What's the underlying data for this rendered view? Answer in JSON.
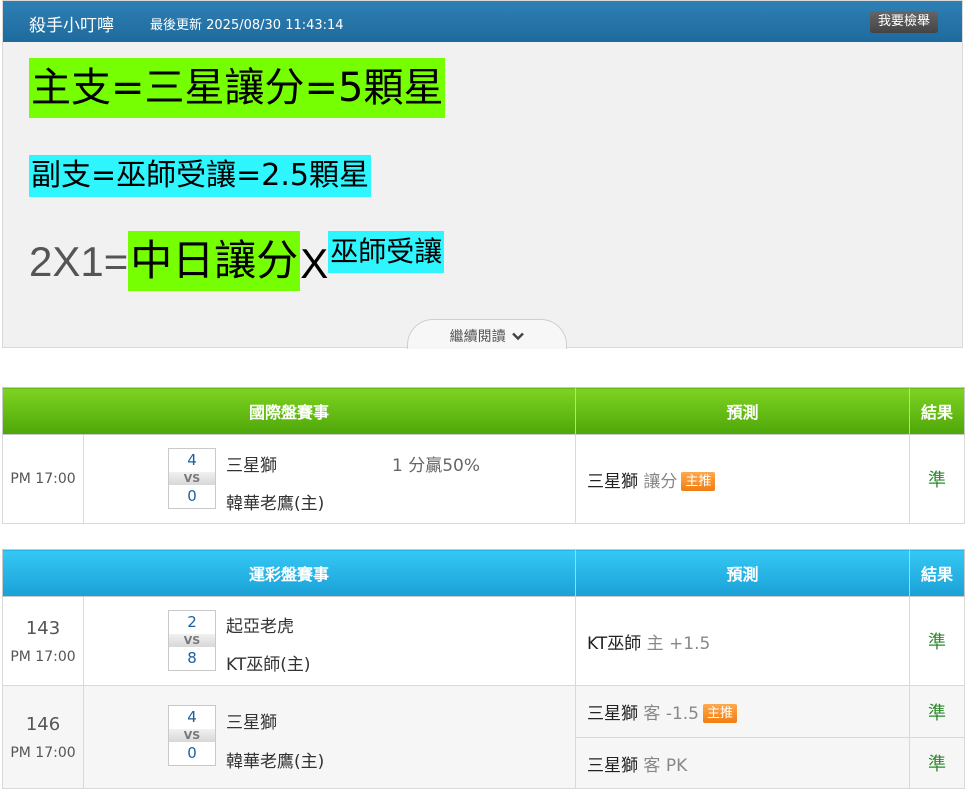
{
  "article": {
    "author": "殺手小叮嚀",
    "updated": "最後更新 2025/08/30 11:43:14",
    "report_label": "我要檢舉",
    "line1": "主支=三星讓分=5顆星",
    "line2": "副支=巫師受讓=2.5顆星",
    "line3_prefix": "2X1=",
    "line3_green": "中日讓分",
    "line3_x": "X",
    "line3_cyan": "巫師受讓",
    "read_more": "繼續閱讀",
    "colors": {
      "green_highlight": "#76ff03",
      "cyan_highlight": "#2ff5ff",
      "header": "#2e80b4"
    }
  },
  "international": {
    "headers": {
      "event": "國際盤賽事",
      "prediction": "預測",
      "result": "結果"
    },
    "header_color": "#5bb413",
    "rows": [
      {
        "time": "PM 17:00",
        "score_top": "4",
        "vs": "VS",
        "score_bottom": "0",
        "team_top": "三星獅",
        "team_bottom": "韓華老鷹(主)",
        "odds": "1 分贏50%",
        "pred_team": "三星獅",
        "pred_type": "讓分",
        "badge": "主推",
        "result": "準"
      }
    ]
  },
  "sports_lottery": {
    "headers": {
      "event": "運彩盤賽事",
      "prediction": "預測",
      "result": "結果"
    },
    "header_color": "#22aee3",
    "rows": [
      {
        "num": "143",
        "time": "PM 17:00",
        "score_top": "2",
        "vs": "VS",
        "score_bottom": "8",
        "team_top": "起亞老虎",
        "team_bottom": "KT巫師(主)",
        "preds": [
          {
            "team": "KT巫師",
            "type": "主 +1.5",
            "badge": "",
            "result": "準"
          }
        ]
      },
      {
        "num": "146",
        "time": "PM 17:00",
        "score_top": "4",
        "vs": "VS",
        "score_bottom": "0",
        "team_top": "三星獅",
        "team_bottom": "韓華老鷹(主)",
        "preds": [
          {
            "team": "三星獅",
            "type": "客 -1.5",
            "badge": "主推",
            "result": "準"
          },
          {
            "team": "三星獅",
            "type": "客 PK",
            "badge": "",
            "result": "準"
          }
        ]
      }
    ]
  }
}
